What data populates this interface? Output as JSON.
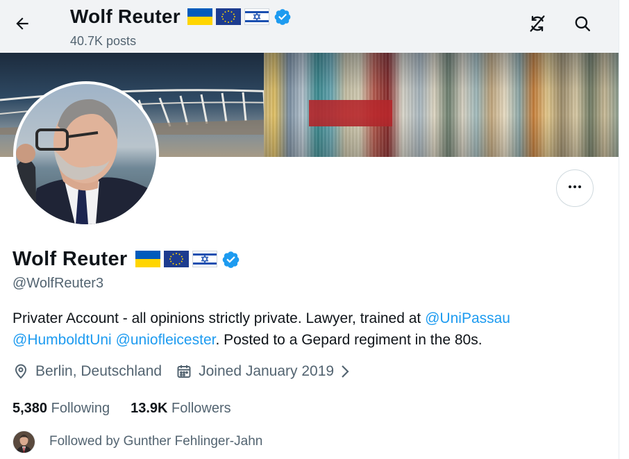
{
  "header": {
    "name": "Wolf Reuter",
    "posts_count": "40.7K posts"
  },
  "profile": {
    "name": "Wolf Reuter",
    "handle": "@WolfReuter3",
    "flags": [
      "ukraine-flag",
      "eu-flag",
      "israel-flag"
    ],
    "verified": true,
    "bio": {
      "text_1": "Privater Account - all opinions strictly private. Lawyer, trained at ",
      "mention_1": "@UniPassau",
      "mention_2": "@HumboldtUni",
      "mention_3": "@uniofleicester",
      "text_2": ".  Posted to a Gepard regiment in the 80s."
    },
    "location": "Berlin, Deutschland",
    "joined": "Joined January 2019",
    "following_count": "5,380",
    "following_label": "Following",
    "followers_count": "13.9K",
    "followers_label": "Followers",
    "followed_by": "Followed by Gunther Fehlinger-Jahn"
  },
  "colors": {
    "accent": "#1d9bf0",
    "text": "#0f1419",
    "muted": "#536471",
    "verified_badge": "#1d9bf0"
  },
  "icons": {
    "back": "arrow-left-icon",
    "sync": "sync-off-icon",
    "search": "search-icon",
    "more": "more-horizontal-icon",
    "location": "location-pin-icon",
    "calendar": "calendar-icon",
    "chevron": "chevron-right-icon"
  }
}
